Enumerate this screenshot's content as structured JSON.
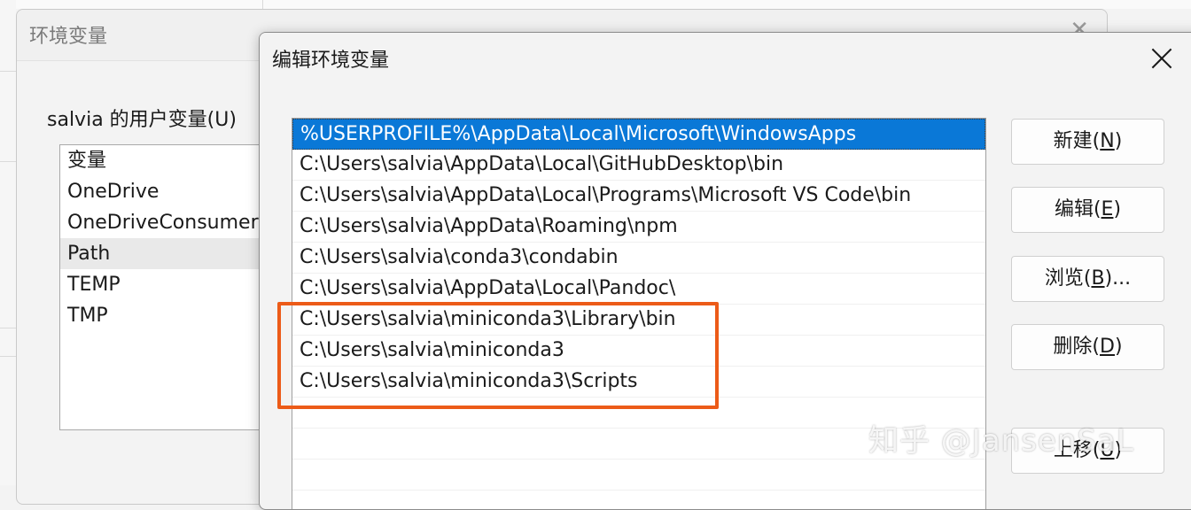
{
  "background_window": {
    "title": "环境变量",
    "close_glyph": "✕",
    "user_vars_label": "salvia 的用户变量(U)",
    "list_header": "变量",
    "variables": [
      "OneDrive",
      "OneDriveConsumer",
      "Path",
      "TEMP",
      "TMP"
    ],
    "selected_variable": "Path"
  },
  "edit_dialog": {
    "title": "编辑环境变量",
    "paths": [
      "%USERPROFILE%\\AppData\\Local\\Microsoft\\WindowsApps",
      "C:\\Users\\salvia\\AppData\\Local\\GitHubDesktop\\bin",
      "C:\\Users\\salvia\\AppData\\Local\\Programs\\Microsoft VS Code\\bin",
      "C:\\Users\\salvia\\AppData\\Roaming\\npm",
      "C:\\Users\\salvia\\conda3\\condabin",
      "C:\\Users\\salvia\\AppData\\Local\\Pandoc\\",
      "C:\\Users\\salvia\\miniconda3\\Library\\bin",
      "C:\\Users\\salvia\\miniconda3",
      "C:\\Users\\salvia\\miniconda3\\Scripts"
    ],
    "selected_index": 0,
    "buttons": {
      "new": {
        "pre": "新建(",
        "key": "N",
        "post": ")"
      },
      "edit": {
        "pre": "编辑(",
        "key": "E",
        "post": ")"
      },
      "browse": {
        "pre": "浏览(",
        "key": "B",
        "post": ")..."
      },
      "delete": {
        "pre": "删除(",
        "key": "D",
        "post": ")"
      },
      "move_up": {
        "pre": "上移(",
        "key": "U",
        "post": ")"
      }
    }
  },
  "watermark": "知乎 @JansenSaL",
  "colors": {
    "selection": "#0a78d7",
    "highlight_box": "#ec5b18"
  }
}
